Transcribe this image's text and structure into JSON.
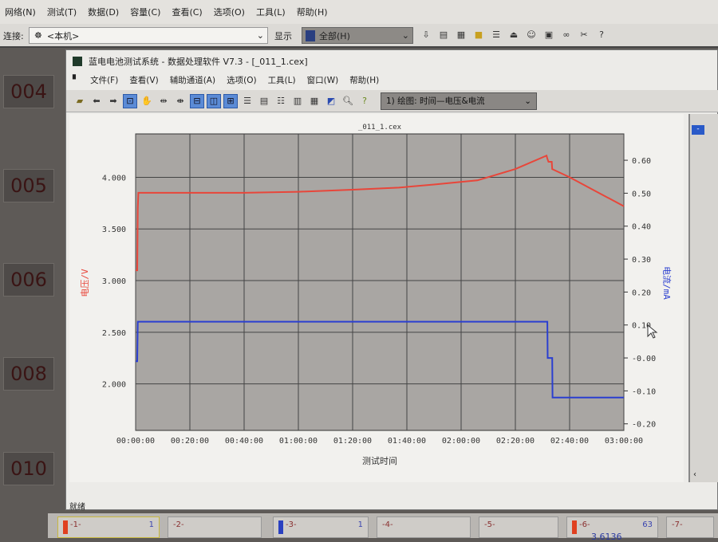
{
  "app": {
    "menu": [
      "网络(N)",
      "测试(T)",
      "数据(D)",
      "容量(C)",
      "查看(C)",
      "选项(O)",
      "工具(L)",
      "帮助(H)"
    ],
    "connect_label": "连接:",
    "connect_value": "<本机>",
    "show_label": "显示",
    "show_value": "全部(H)"
  },
  "tiles": [
    "004",
    "005",
    "006",
    "008",
    "010"
  ],
  "window": {
    "title": "蓝电电池测试系统 - 数据处理软件 V7.3 - [_011_1.cex]",
    "menu": [
      "文件(F)",
      "查看(V)",
      "辅助通道(A)",
      "选项(O)",
      "工具(L)",
      "窗口(W)",
      "帮助(H)"
    ],
    "plot_select": "1) 绘图: 时间—电压&电流",
    "status": "就绪",
    "side_btn": "-"
  },
  "bottom_tabs": [
    {
      "label": "-1-",
      "count": "1"
    },
    {
      "label": "-2-",
      "count": ""
    },
    {
      "label": "-3-",
      "count": "1"
    },
    {
      "label": "-4-",
      "count": ""
    },
    {
      "label": "-5-",
      "count": ""
    },
    {
      "label": "-6-",
      "count": "63",
      "value": "3.6136"
    },
    {
      "label": "-7-",
      "count": ""
    }
  ],
  "colors": {
    "voltage": "#e8463a",
    "current": "#2b3fd0",
    "plot_bg": "#a9a6a3"
  },
  "chart_data": {
    "type": "line",
    "title": "_011_1.cex",
    "xlabel": "测试时间",
    "ylabel": "电压/V",
    "y2label": "电流/mA",
    "xlim_min": [
      0,
      180
    ],
    "ylim": [
      1.55,
      4.42
    ],
    "y2lim": [
      -0.22,
      0.68
    ],
    "x_ticks": [
      "00:00:00",
      "00:20:00",
      "00:40:00",
      "01:00:00",
      "01:20:00",
      "01:40:00",
      "02:00:00",
      "02:20:00",
      "02:40:00",
      "03:00:00"
    ],
    "y_ticks": [
      [
        "4.000",
        4.0
      ],
      [
        "3.500",
        3.5
      ],
      [
        "3.000",
        3.0
      ],
      [
        "2.500",
        2.5
      ],
      [
        "2.000",
        2.0
      ]
    ],
    "y2_ticks": [
      [
        "0.60",
        0.6
      ],
      [
        "0.50",
        0.5
      ],
      [
        "0.40",
        0.4
      ],
      [
        "0.30",
        0.3
      ],
      [
        "0.20",
        0.2
      ],
      [
        "0.10",
        0.1
      ],
      [
        "-0.00",
        0.0
      ],
      [
        "-0.10",
        -0.1
      ],
      [
        "-0.20",
        -0.2
      ]
    ],
    "series": [
      {
        "name": "电压",
        "axis": "left",
        "points": [
          [
            0,
            3.1
          ],
          [
            0.6,
            3.1
          ],
          [
            0.8,
            3.7
          ],
          [
            1,
            3.85
          ],
          [
            20,
            3.85
          ],
          [
            40,
            3.85
          ],
          [
            60,
            3.86
          ],
          [
            80,
            3.88
          ],
          [
            97,
            3.9
          ],
          [
            110,
            3.93
          ],
          [
            126,
            3.97
          ],
          [
            140,
            4.08
          ],
          [
            151.5,
            4.21
          ],
          [
            151.8,
            4.18
          ],
          [
            152.2,
            4.15
          ],
          [
            153.4,
            4.15
          ],
          [
            153.6,
            4.08
          ],
          [
            160,
            4.0
          ],
          [
            170,
            3.86
          ],
          [
            180,
            3.72
          ]
        ]
      },
      {
        "name": "电流",
        "axis": "right",
        "points": [
          [
            0,
            -0.01
          ],
          [
            0.6,
            -0.01
          ],
          [
            0.8,
            0.11
          ],
          [
            151.8,
            0.11
          ],
          [
            151.9,
            0.0
          ],
          [
            153.6,
            0.0
          ],
          [
            153.7,
            -0.12
          ],
          [
            180,
            -0.12
          ]
        ]
      }
    ]
  }
}
